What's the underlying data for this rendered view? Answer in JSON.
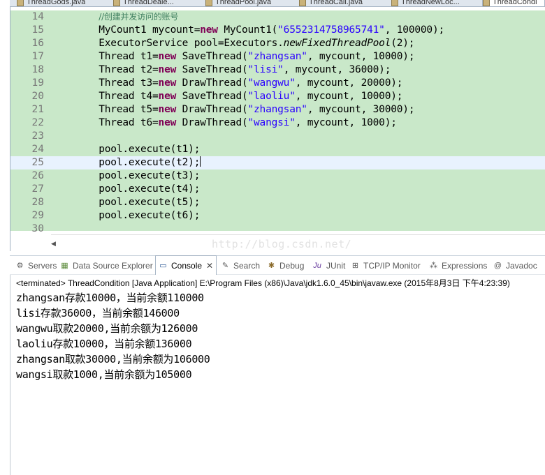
{
  "editor_tabs": [
    {
      "label": "ThreadGods.java"
    },
    {
      "label": "ThreadDeale..."
    },
    {
      "label": "ThreadPool.java"
    },
    {
      "label": "ThreadCall.java"
    },
    {
      "label": "ThreadNewLoc..."
    },
    {
      "label": "ThreadCondi"
    }
  ],
  "code_lines": [
    {
      "n": "14",
      "segments": [
        {
          "t": "        "
        },
        {
          "t": "//创建并发访问的账号",
          "c": "comment"
        }
      ]
    },
    {
      "n": "15",
      "segments": [
        {
          "t": "        MyCount1 mycount="
        },
        {
          "t": "new",
          "c": "kw"
        },
        {
          "t": " MyCount1("
        },
        {
          "t": "\"6552314758965741\"",
          "c": "str"
        },
        {
          "t": ", 100000);"
        }
      ]
    },
    {
      "n": "16",
      "segments": [
        {
          "t": "        ExecutorService pool=Executors."
        },
        {
          "t": "newFixedThreadPool",
          "c": "static"
        },
        {
          "t": "(2);"
        }
      ]
    },
    {
      "n": "17",
      "segments": [
        {
          "t": "        Thread t1="
        },
        {
          "t": "new",
          "c": "kw"
        },
        {
          "t": " SaveThread("
        },
        {
          "t": "\"zhangsan\"",
          "c": "str"
        },
        {
          "t": ", mycount, 10000);"
        }
      ]
    },
    {
      "n": "18",
      "segments": [
        {
          "t": "        Thread t2="
        },
        {
          "t": "new",
          "c": "kw"
        },
        {
          "t": " SaveThread("
        },
        {
          "t": "\"lisi\"",
          "c": "str"
        },
        {
          "t": ", mycount, 36000);"
        }
      ]
    },
    {
      "n": "19",
      "segments": [
        {
          "t": "        Thread t3="
        },
        {
          "t": "new",
          "c": "kw"
        },
        {
          "t": " DrawThread("
        },
        {
          "t": "\"wangwu\"",
          "c": "str"
        },
        {
          "t": ", mycount, 20000);"
        }
      ]
    },
    {
      "n": "20",
      "segments": [
        {
          "t": "        Thread t4="
        },
        {
          "t": "new",
          "c": "kw"
        },
        {
          "t": " SaveThread("
        },
        {
          "t": "\"laoliu\"",
          "c": "str"
        },
        {
          "t": ", mycount, 10000);"
        }
      ]
    },
    {
      "n": "21",
      "segments": [
        {
          "t": "        Thread t5="
        },
        {
          "t": "new",
          "c": "kw"
        },
        {
          "t": " DrawThread("
        },
        {
          "t": "\"zhangsan\"",
          "c": "str"
        },
        {
          "t": ", mycount, 30000);"
        }
      ]
    },
    {
      "n": "22",
      "segments": [
        {
          "t": "        Thread t6="
        },
        {
          "t": "new",
          "c": "kw"
        },
        {
          "t": " DrawThread("
        },
        {
          "t": "\"wangsi\"",
          "c": "str"
        },
        {
          "t": ", mycount, 1000);"
        }
      ]
    },
    {
      "n": "23",
      "segments": [
        {
          "t": ""
        }
      ]
    },
    {
      "n": "24",
      "segments": [
        {
          "t": "        pool.execute(t1);"
        }
      ]
    },
    {
      "n": "25",
      "segments": [
        {
          "t": "        pool.execute(t2);"
        }
      ],
      "current": true
    },
    {
      "n": "26",
      "segments": [
        {
          "t": "        pool.execute(t3);"
        }
      ]
    },
    {
      "n": "27",
      "segments": [
        {
          "t": "        pool.execute(t4);"
        }
      ]
    },
    {
      "n": "28",
      "segments": [
        {
          "t": "        pool.execute(t5);"
        }
      ]
    },
    {
      "n": "29",
      "segments": [
        {
          "t": "        pool.execute(t6);"
        }
      ]
    },
    {
      "n": "30",
      "segments": [
        {
          "t": ""
        }
      ]
    }
  ],
  "watermark": "http://blog.csdn.net/",
  "view_tabs": [
    {
      "label": "Servers",
      "icon": "servers-icon",
      "glyph": "⚙"
    },
    {
      "label": "Data Source Explorer",
      "icon": "data-source-icon",
      "glyph": "▦"
    },
    {
      "label": "Console",
      "icon": "console-icon",
      "glyph": "▭",
      "active": true
    },
    {
      "label": "Search",
      "icon": "search-icon",
      "glyph": "✎"
    },
    {
      "label": "Debug",
      "icon": "debug-icon",
      "glyph": "✱"
    },
    {
      "label": "JUnit",
      "icon": "junit-icon",
      "glyph": "Ju"
    },
    {
      "label": "TCP/IP Monitor",
      "icon": "tcpip-monitor-icon",
      "glyph": "⊞"
    },
    {
      "label": "Expressions",
      "icon": "expressions-icon",
      "glyph": "⁂"
    },
    {
      "label": "Javadoc",
      "icon": "javadoc-icon",
      "glyph": "@"
    }
  ],
  "console_close": "✕",
  "console_header": "<terminated> ThreadCondition [Java Application] E:\\Program Files (x86)\\Java\\jdk1.6.0_45\\bin\\javaw.exe (2015年8月3日 下午4:23:39)",
  "console_output": [
    "zhangsan存款10000，当前余额110000",
    "lisi存款36000，当前余额146000",
    "wangwu取款20000,当前余额为126000",
    "laoliu存款10000，当前余额136000",
    "zhangsan取款30000,当前余额为106000",
    "wangsi取款1000,当前余额为105000"
  ],
  "colors": {
    "changed_line_bg": "#c9e8c9",
    "current_line_bg": "#e8f2fe",
    "keyword": "#7f0055",
    "string": "#2a00ff",
    "comment": "#3f7f5f",
    "line_number": "#787878"
  }
}
